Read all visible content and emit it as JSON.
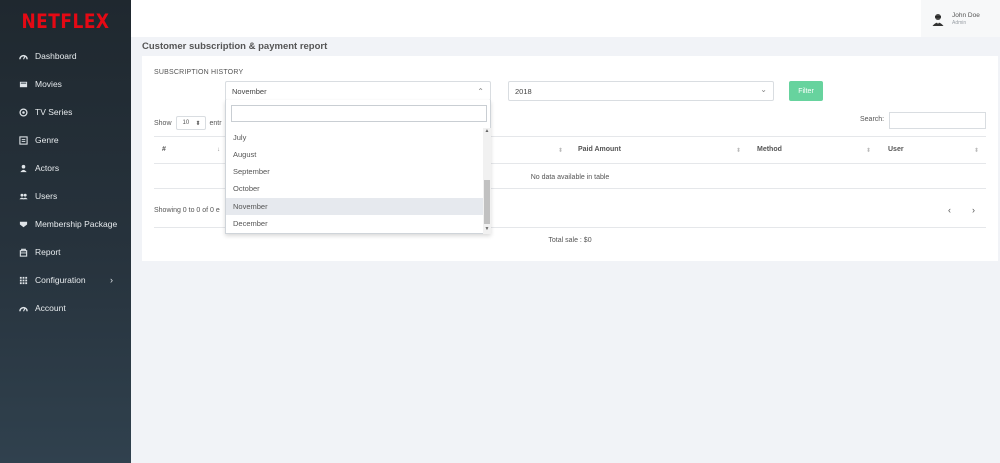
{
  "brand": {
    "logo": "NETFLEX"
  },
  "sidebar": {
    "items": [
      {
        "label": "Dashboard",
        "icon": "dashboard-icon"
      },
      {
        "label": "Movies",
        "icon": "movies-icon"
      },
      {
        "label": "TV Series",
        "icon": "tv-icon"
      },
      {
        "label": "Genre",
        "icon": "list-icon"
      },
      {
        "label": "Actors",
        "icon": "person-icon"
      },
      {
        "label": "Users",
        "icon": "users-icon"
      },
      {
        "label": "Membership Package",
        "icon": "package-icon"
      },
      {
        "label": "Report",
        "icon": "report-icon"
      },
      {
        "label": "Configuration",
        "icon": "grid-icon",
        "chevron": "›"
      },
      {
        "label": "Account",
        "icon": "dashboard-icon"
      }
    ]
  },
  "user": {
    "name": "John Doe",
    "role": "Admin"
  },
  "page": {
    "title": "Customer subscription & payment report"
  },
  "report": {
    "section_title": "SUBSCRIPTION HISTORY",
    "month_select": "November",
    "year_select": "2018",
    "filter_label": "Filter",
    "show_label": "Show",
    "page_length": "10",
    "entries_label": "entr",
    "search_label": "Search:",
    "columns": [
      "#",
      "Paid Amount",
      "Method",
      "User"
    ],
    "empty_message": "No data available in table",
    "showing_info": "Showing 0 to 0 of 0 e",
    "prev": "‹",
    "next": "›",
    "total_sale": "Total sale : $0"
  },
  "dropdown": {
    "options": [
      "July",
      "August",
      "September",
      "October",
      "November",
      "December"
    ],
    "selected": "November"
  },
  "colors": {
    "accent": "#67d39e",
    "brand": "#e50914",
    "sidebar": "#27333d"
  }
}
